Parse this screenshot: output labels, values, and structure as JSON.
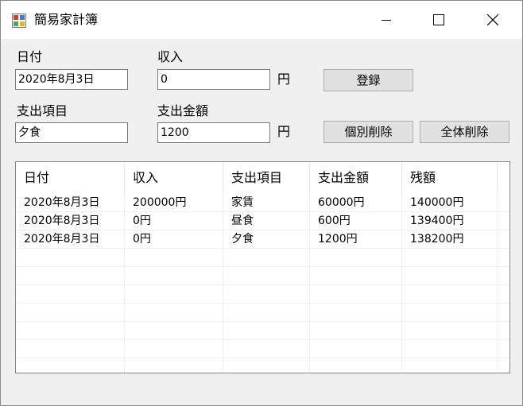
{
  "window": {
    "title": "簡易家計簿",
    "icon": "app-icon"
  },
  "form": {
    "date_label": "日付",
    "date_value": "2020年8月3日",
    "income_label": "収入",
    "income_value": "0",
    "income_unit": "円",
    "expense_item_label": "支出項目",
    "expense_item_value": "夕食",
    "expense_amount_label": "支出金額",
    "expense_amount_value": "1200",
    "expense_unit": "円"
  },
  "buttons": {
    "register": "登録",
    "delete_selected": "個別削除",
    "delete_all": "全体削除"
  },
  "table": {
    "columns": [
      "日付",
      "収入",
      "支出項目",
      "支出金額",
      "残額"
    ],
    "rows": [
      [
        "2020年8月3日",
        "200000円",
        "家賃",
        "60000円",
        "140000円"
      ],
      [
        "2020年8月3日",
        "0円",
        "昼食",
        "600円",
        "139400円"
      ],
      [
        "2020年8月3日",
        "0円",
        "夕食",
        "1200円",
        "138200円"
      ]
    ]
  }
}
